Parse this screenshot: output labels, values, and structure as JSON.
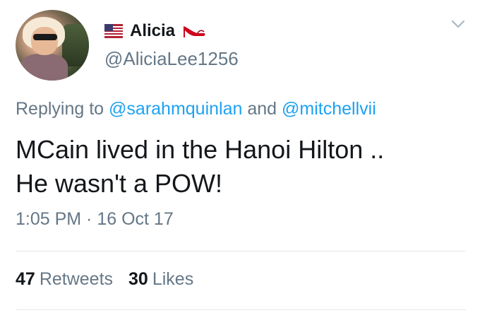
{
  "user": {
    "display_name": "Alicia",
    "handle": "@AliciaLee1256",
    "flag_icon": "us-flag-icon",
    "badge_icon": "high-heel-icon"
  },
  "reply": {
    "prefix": "Replying to ",
    "mention_1": "@sarahmquinlan",
    "joiner": " and ",
    "mention_2": "@mitchellvii"
  },
  "tweet": {
    "line_1": "MCain lived in the Hanoi Hilton ..",
    "line_2": "He wasn't a POW!",
    "timestamp": "1:05 PM · 16 Oct 17"
  },
  "stats": {
    "retweets_count": "47",
    "retweets_label": "Retweets",
    "likes_count": "30",
    "likes_label": "Likes"
  },
  "colors": {
    "link": "#1da1f2",
    "secondary_text": "#657786",
    "primary_text": "#14171a",
    "divider": "#e1e8ed"
  }
}
